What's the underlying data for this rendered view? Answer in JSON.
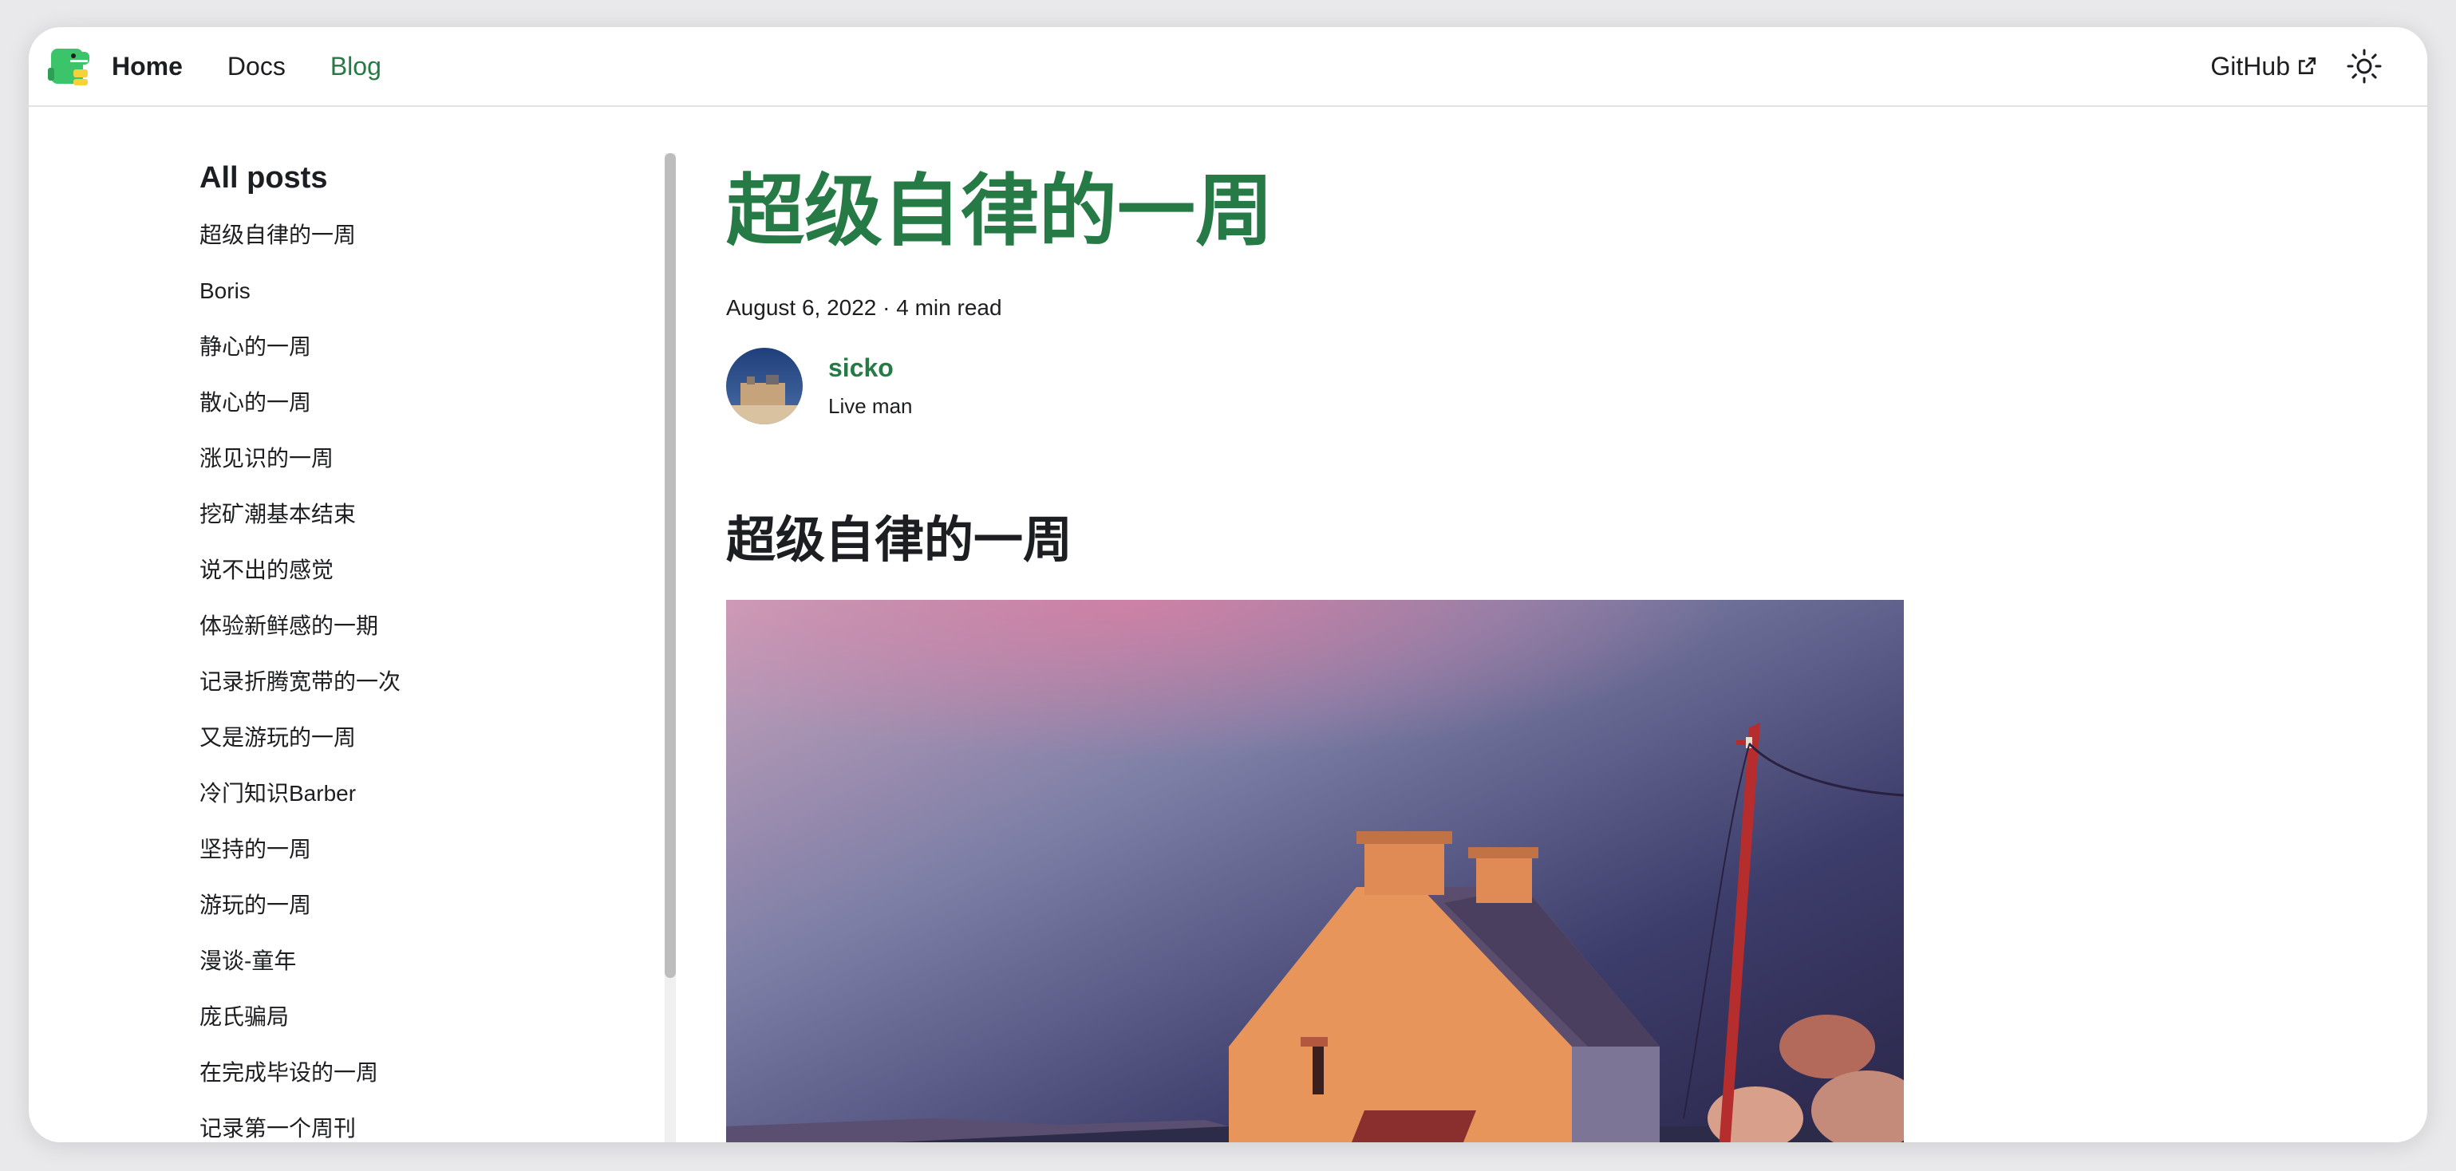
{
  "navbar": {
    "brand": "Home",
    "links": [
      "Docs",
      "Blog"
    ],
    "github": "GitHub",
    "logo_icon": "dinosaur-logo-icon",
    "theme_icon": "sun-icon",
    "external_icon": "external-link-icon"
  },
  "sidebar": {
    "title": "All posts",
    "posts": [
      "超级自律的一周",
      "Boris",
      "静心的一周",
      "散心的一周",
      "涨见识的一周",
      "挖矿潮基本结束",
      "说不出的感觉",
      "体验新鲜感的一期",
      "记录折腾宽带的一次",
      "又是游玩的一周",
      "冷门知识Barber",
      "坚持的一周",
      "游玩的一周",
      "漫谈-童年",
      "庞氏骗局",
      "在完成毕设的一周",
      "记录第一个周刊"
    ]
  },
  "article": {
    "title": "超级自律的一周",
    "meta": "August 6, 2022 · 4 min read",
    "author_name": "sicko",
    "author_title": "Live man",
    "heading": "超级自律的一周"
  },
  "colors": {
    "accent": "#267a45",
    "text": "#1c1e21"
  }
}
